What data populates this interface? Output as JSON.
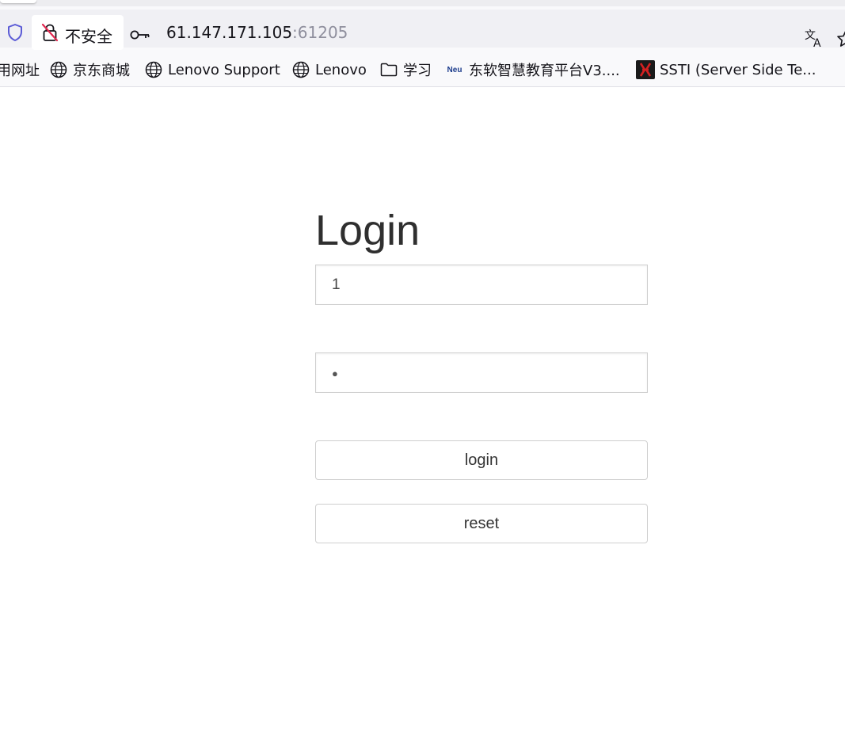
{
  "browser": {
    "security_label": "不安全",
    "url_host": "61.147.171.105",
    "url_port": ":61205",
    "bookmarks": [
      {
        "label": "用网址",
        "icon": "none"
      },
      {
        "label": "京东商城",
        "icon": "globe-icon"
      },
      {
        "label": "Lenovo Support",
        "icon": "globe-icon"
      },
      {
        "label": "Lenovo",
        "icon": "globe-icon"
      },
      {
        "label": "学习",
        "icon": "folder-icon"
      },
      {
        "label": "东软智慧教育平台V3....",
        "icon": "neu-logo",
        "badge_text": "Neu"
      },
      {
        "label": "SSTI (Server Side Te...",
        "icon": "ssti-favicon"
      }
    ]
  },
  "page": {
    "title": "Login",
    "username_value": "1",
    "password_mask": "●",
    "login_label": "login",
    "reset_label": "reset"
  },
  "colors": {
    "toolbar_bg": "#f0f0f4",
    "bookmarks_bg": "#f9f9fb",
    "shield_accent": "#5b5bd6",
    "insecure_accent": "#e22850"
  }
}
